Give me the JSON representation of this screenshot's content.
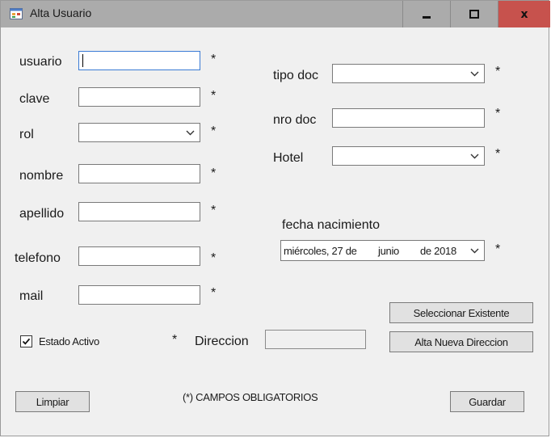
{
  "window": {
    "title": "Alta Usuario",
    "close_glyph": "x"
  },
  "form": {
    "usuario_label": "usuario",
    "clave_label": "clave",
    "rol_label": "rol",
    "nombre_label": "nombre",
    "apellido_label": "apellido",
    "telefono_label": "telefono",
    "mail_label": "mail",
    "tipo_doc_label": "tipo doc",
    "nro_doc_label": "nro doc",
    "hotel_label": "Hotel",
    "fecha_label": "fecha nacimiento",
    "direccion_label": "Direccion",
    "required_mark": "*",
    "estado_activo_label": "Estado Activo",
    "estado_activo_checked": true,
    "usuario_value": "",
    "clave_value": "",
    "nombre_value": "",
    "apellido_value": "",
    "telefono_value": "",
    "mail_value": "",
    "nro_doc_value": "",
    "direccion_value": "",
    "rol_selected": "",
    "tipo_doc_selected": "",
    "hotel_selected": "",
    "fecha_weekday_day": "miércoles, 27 de",
    "fecha_month": "junio",
    "fecha_year": "de 2018",
    "campos_obligatorios": "(*) CAMPOS OBLIGATORIOS"
  },
  "buttons": {
    "seleccionar_existente": "Seleccionar Existente",
    "alta_nueva_direccion": "Alta Nueva Direccion",
    "limpiar": "Limpiar",
    "guardar": "Guardar"
  },
  "icons": {
    "app": "form-app-icon",
    "dropdown": "chevron-down-icon",
    "check": "checkmark-icon"
  },
  "colors": {
    "title_bar": "#ababab",
    "close_button": "#c7524d",
    "focus_border": "#3a7bd5",
    "form_background": "#f0f0f0"
  }
}
